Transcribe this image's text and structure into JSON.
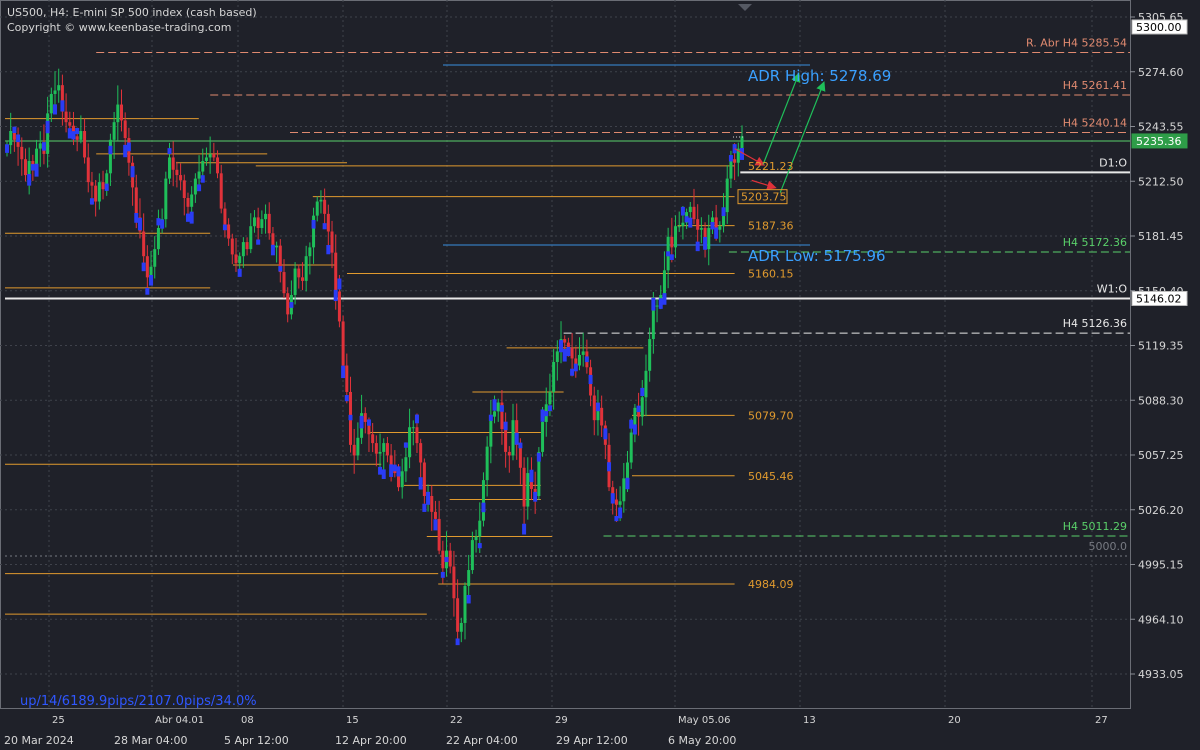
{
  "header": {
    "title": "US500, H4:  E-mini SP 500 index (cash based)",
    "copyright": "Copyright © www.keenbase-trading.com"
  },
  "stats_text": "up/14/6189.9pips/2107.0pips/34.0%",
  "colors": {
    "background": "#1f2129",
    "bull": "#1fbf5a",
    "bear": "#e0323a",
    "tick": "#2a3cf5",
    "orange": "#e09a2e",
    "salmon": "#e08a70",
    "white": "#e8e8e8",
    "green": "#5ad06a",
    "blue_level": "#3a8fe0",
    "adr_text": "#3aa0ff"
  },
  "chart_data": {
    "type": "candlestick",
    "symbol": "US500",
    "timeframe": "H4",
    "ylim": [
      4902,
      5318
    ],
    "y_ticks": [
      "5305.65",
      "5274.60",
      "5243.55",
      "5212.50",
      "5181.45",
      "5150.40",
      "5119.35",
      "5088.30",
      "5057.25",
      "5026.20",
      "4995.15",
      "4964.10",
      "4933.05"
    ],
    "x_ticks_top": [
      "25",
      "Abr 04.01",
      "08",
      "15",
      "22",
      "29",
      "May 05.06",
      "13",
      "20",
      "27"
    ],
    "x_ticks_bottom": [
      "20 Mar 2024",
      "28 Mar 04:00",
      "5 Apr 12:00",
      "12 Apr 20:00",
      "22 Apr 04:00",
      "29 Apr 12:00",
      "6 May 20:00"
    ],
    "price_boxes": [
      {
        "value": 5300.0,
        "text": "5300.00",
        "style": "white"
      },
      {
        "value": 5235.36,
        "text": "5235.36",
        "style": "green"
      },
      {
        "value": 5146.02,
        "text": "5146.02",
        "style": "white"
      }
    ],
    "levels": [
      {
        "price": 5285.54,
        "style": "dashed",
        "color": "salmon",
        "start_day": 8,
        "label": "R. Abr H4 5285.54",
        "label_pos": "right"
      },
      {
        "price": 5261.41,
        "style": "dashed",
        "color": "salmon",
        "start_day": 18,
        "label": "H4 5261.41",
        "label_pos": "right"
      },
      {
        "price": 5240.14,
        "style": "dashed",
        "color": "salmon",
        "start_day": 25,
        "label": "H4 5240.14",
        "label_pos": "right"
      },
      {
        "price": 5235.36,
        "style": "solid",
        "color": "green",
        "start_day": 0,
        "label": "",
        "label_pos": "none"
      },
      {
        "price": 5217.5,
        "style": "solid",
        "color": "white",
        "start_day": 64.5,
        "label": "D1:O",
        "label_pos": "right"
      },
      {
        "price": 5172.36,
        "style": "dashed",
        "color": "green",
        "start_day": 63.5,
        "label": "H4 5172.36",
        "label_pos": "right"
      },
      {
        "price": 5146.02,
        "style": "solid",
        "color": "white",
        "start_day": 0,
        "label": "W1:O",
        "label_pos": "right"
      },
      {
        "price": 5126.36,
        "style": "dashed",
        "color": "white",
        "start_day": 49,
        "label": "H4 5126.36",
        "label_pos": "right"
      },
      {
        "price": 5011.29,
        "style": "dashed",
        "color": "green",
        "start_day": 52.5,
        "label": "H4 5011.29",
        "label_pos": "right"
      },
      {
        "price": 5000.0,
        "style": "dotted",
        "color": "grey",
        "start_day": 0,
        "label": "5000.0",
        "label_pos": "right"
      }
    ],
    "adr": {
      "high": {
        "price": 5278.69,
        "label": "ADR High: 5278.69"
      },
      "low": {
        "price": 5175.96,
        "label": "ADR Low: 5175.96"
      }
    },
    "pivot_labels": [
      {
        "price": 5221.23,
        "text": "5221.23",
        "boxed": false
      },
      {
        "price": 5203.75,
        "text": "5203.75",
        "boxed": true
      },
      {
        "price": 5187.36,
        "text": "5187.36",
        "boxed": false
      },
      {
        "price": 5160.15,
        "text": "5160.15",
        "boxed": false
      },
      {
        "price": 5079.7,
        "text": "5079.70",
        "boxed": false
      },
      {
        "price": 5045.46,
        "text": "5045.46",
        "boxed": false
      },
      {
        "price": 4984.09,
        "text": "4984.09",
        "boxed": false
      }
    ],
    "orange_segments": [
      {
        "price": 5248,
        "from": 0,
        "to": 17
      },
      {
        "price": 5228,
        "from": 8,
        "to": 23
      },
      {
        "price": 5223,
        "from": 15,
        "to": 30
      },
      {
        "price": 5221.23,
        "from": 22,
        "to": 64
      },
      {
        "price": 5203.75,
        "from": 27,
        "to": 64
      },
      {
        "price": 5187.36,
        "from": 59,
        "to": 64
      },
      {
        "price": 5183,
        "from": 0,
        "to": 18
      },
      {
        "price": 5165,
        "from": 20,
        "to": 29
      },
      {
        "price": 5160.15,
        "from": 30,
        "to": 64
      },
      {
        "price": 5152,
        "from": 0,
        "to": 18
      },
      {
        "price": 5118,
        "from": 44,
        "to": 56
      },
      {
        "price": 5093,
        "from": 41,
        "to": 49
      },
      {
        "price": 5079.7,
        "from": 55,
        "to": 64
      },
      {
        "price": 5070,
        "from": 32,
        "to": 47
      },
      {
        "price": 5052,
        "from": 0,
        "to": 33
      },
      {
        "price": 5045.46,
        "from": 55,
        "to": 64
      },
      {
        "price": 5040,
        "from": 35,
        "to": 47
      },
      {
        "price": 5032,
        "from": 39,
        "to": 47
      },
      {
        "price": 5011,
        "from": 37,
        "to": 48
      },
      {
        "price": 4990,
        "from": 0,
        "to": 38
      },
      {
        "price": 4984.09,
        "from": 38,
        "to": 64
      },
      {
        "price": 4967,
        "from": 0,
        "to": 37
      }
    ],
    "arrows": [
      {
        "color": "red",
        "from": [
          64,
          5231
        ],
        "to": [
          66.5,
          5222
        ]
      },
      {
        "color": "red",
        "from": [
          65.5,
          5213
        ],
        "to": [
          67.5,
          5209
        ]
      },
      {
        "color": "green",
        "from": [
          66.5,
          5222
        ],
        "to": [
          69.6,
          5273
        ]
      },
      {
        "color": "green",
        "from": [
          68,
          5206
        ],
        "to": [
          71.8,
          5268
        ]
      }
    ],
    "candles_close": [
      5233,
      5241,
      5236,
      5232,
      5225,
      5216,
      5224,
      5222,
      5231,
      5234,
      5228,
      5251,
      5262,
      5264,
      5267,
      5252,
      5246,
      5244,
      5238,
      5236,
      5241,
      5226,
      5212,
      5210,
      5201,
      5212,
      5208,
      5217,
      5236,
      5246,
      5256,
      5247,
      5237,
      5223,
      5209,
      5192,
      5184,
      5170,
      5158,
      5164,
      5174,
      5186,
      5191,
      5214,
      5226,
      5219,
      5216,
      5213,
      5203,
      5198,
      5205,
      5214,
      5218,
      5224,
      5226,
      5228,
      5226,
      5217,
      5197,
      5188,
      5180,
      5171,
      5166,
      5170,
      5178,
      5174,
      5187,
      5192,
      5186,
      5191,
      5194,
      5183,
      5175,
      5176,
      5161,
      5149,
      5137,
      5148,
      5163,
      5158,
      5156,
      5170,
      5175,
      5193,
      5201,
      5202,
      5194,
      5184,
      5172,
      5150,
      5133,
      5108,
      5093,
      5063,
      5057,
      5067,
      5081,
      5076,
      5069,
      5064,
      5058,
      5059,
      5064,
      5057,
      5050,
      5047,
      5039,
      5048,
      5056,
      5073,
      5073,
      5064,
      5053,
      5034,
      5034,
      5025,
      5021,
      5003,
      4993,
      5003,
      4994,
      4976,
      4957,
      4962,
      4983,
      4992,
      5009,
      5011,
      5020,
      5043,
      5062,
      5079,
      5082,
      5087,
      5072,
      5059,
      5057,
      5077,
      5063,
      5050,
      5028,
      5047,
      5038,
      5034,
      5059,
      5076,
      5086,
      5093,
      5110,
      5116,
      5123,
      5121,
      5118,
      5112,
      5108,
      5114,
      5116,
      5107,
      5091,
      5077,
      5084,
      5074,
      5063,
      5039,
      5032,
      5029,
      5031,
      5044,
      5053,
      5070,
      5084,
      5079,
      5090,
      5105,
      5123,
      5142,
      5142,
      5148,
      5162,
      5181,
      5175,
      5187,
      5187,
      5189,
      5195,
      5198,
      5191,
      5185,
      5186,
      5174,
      5186,
      5192,
      5185,
      5187,
      5195,
      5214,
      5225,
      5223,
      5231,
      5238
    ]
  }
}
